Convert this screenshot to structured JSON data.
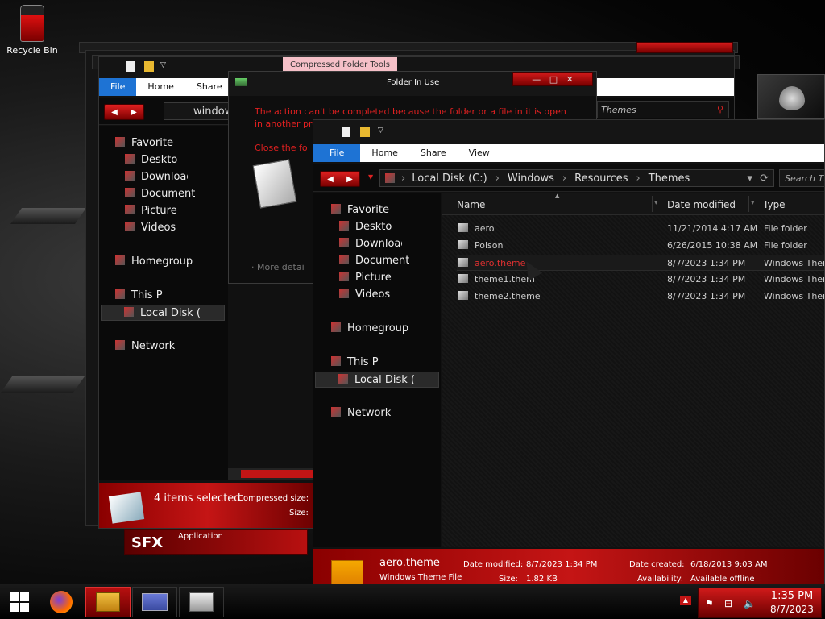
{
  "desktop": {
    "recycle_bin": "Recycle Bin"
  },
  "back_window": {
    "ribbon_tabs": [
      "File",
      "Home",
      "Share"
    ],
    "compressed_tools": "Compressed Folder Tools",
    "address": "window",
    "search_placeholder": "Themes",
    "nav": [
      "Favorite",
      "Desktop",
      "Download:",
      "Document",
      "Picture",
      "Videos",
      "Homegroup",
      "This P",
      "Local Disk (",
      "Network"
    ],
    "status_count": "4 items selected",
    "status_compressed": "Compressed size:",
    "status_size": "Size:",
    "sfx_label": "SFX",
    "sfx_type": "Application"
  },
  "dialog": {
    "title": "Folder In Use",
    "message": "The action can't be completed because the folder or a file in it is open in another pro",
    "close_hint": "Close the fo",
    "more_details": "More detai"
  },
  "front_window": {
    "ribbon_tabs": [
      "File",
      "Home",
      "Share",
      "View"
    ],
    "breadcrumb": [
      "Local Disk (C:)",
      "Windows",
      "Resources",
      "Themes"
    ],
    "search_placeholder": "Search Th",
    "nav": [
      "Favorite",
      "Desktop",
      "Download:",
      "Document",
      "Picture",
      "Videos",
      "Homegroup",
      "This P",
      "Local Disk (",
      "Network"
    ],
    "columns": [
      "Name",
      "Date modified",
      "Type"
    ],
    "files": [
      {
        "name": "aero",
        "date": "11/21/2014 4:17 AM",
        "type": "File folder"
      },
      {
        "name": "Poison",
        "date": "6/26/2015 10:38 AM",
        "type": "File folder"
      },
      {
        "name": "aero.theme",
        "date": "8/7/2023 1:34 PM",
        "type": "Windows Them"
      },
      {
        "name": "theme1.them",
        "date": "8/7/2023 1:34 PM",
        "type": "Windows Them"
      },
      {
        "name": "theme2.theme",
        "date": "8/7/2023 1:34 PM",
        "type": "Windows Them"
      }
    ],
    "details": {
      "filename": "aero.theme",
      "filetype": "Windows Theme File",
      "modified_label": "Date modified:",
      "modified_value": "8/7/2023 1:34 PM",
      "size_label": "Size:",
      "size_value": "1.82 KB",
      "created_label": "Date created:",
      "created_value": "6/18/2013 9:03 AM",
      "avail_label": "Availability:",
      "avail_value": "Available offline"
    }
  },
  "clock": {
    "time": "1:35 PM",
    "date": "8/7/2023"
  },
  "colors": {
    "accent": "#c51515",
    "ribbon_file": "#1e73d4",
    "selected_text": "#e03030"
  }
}
